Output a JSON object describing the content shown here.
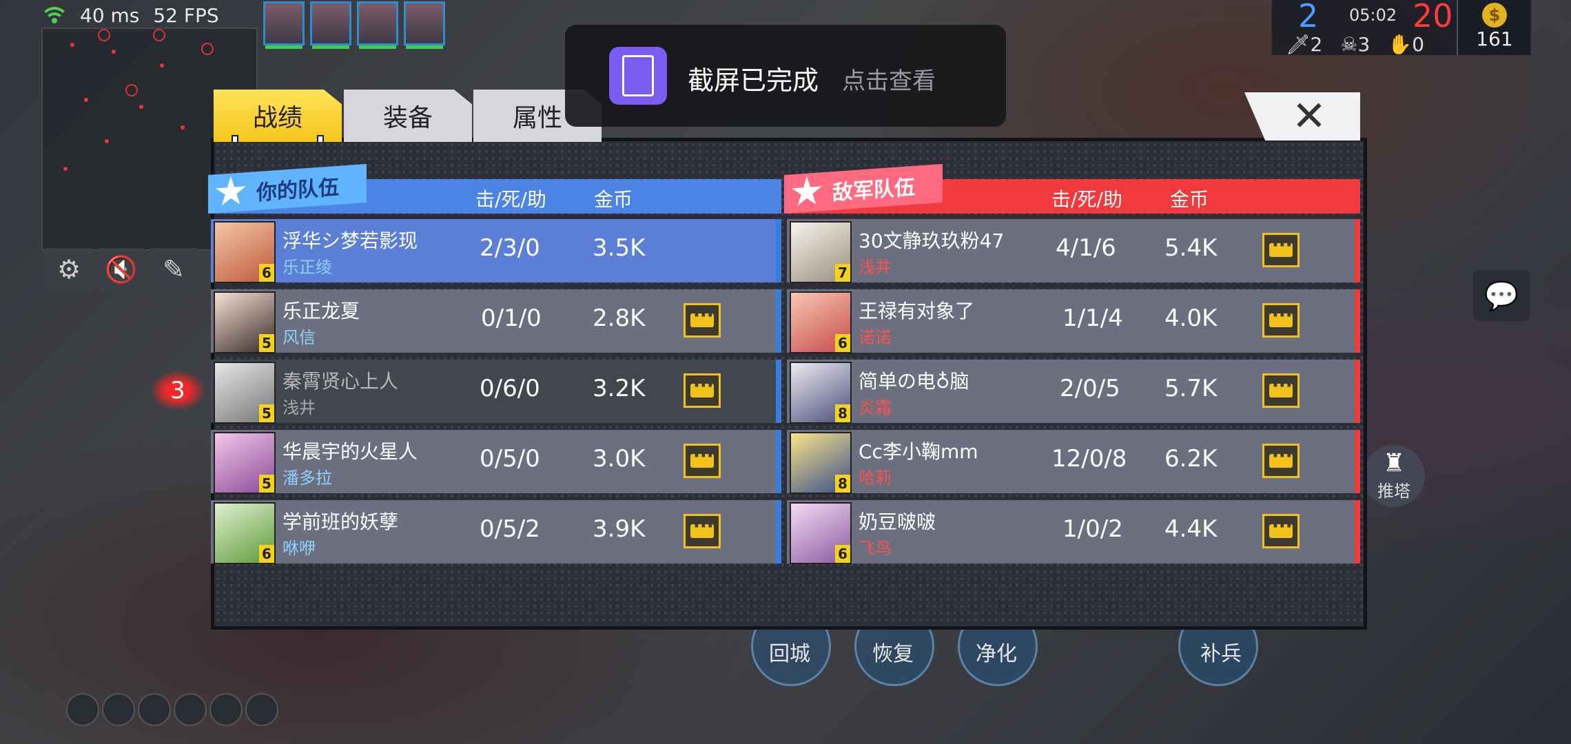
{
  "hud": {
    "ping": "40 ms",
    "fps": "52 FPS",
    "score_blue": "2",
    "game_time": "05:02",
    "score_red": "20",
    "kills": "2",
    "deaths": "3",
    "assists": "0",
    "gold": "161",
    "kill_count_marker": "3",
    "tower_label": "推塔",
    "skills": [
      "回城",
      "恢复",
      "净化",
      "补兵"
    ]
  },
  "toast": {
    "title": "截屏已完成",
    "link": "点击查看"
  },
  "tabs": [
    "战绩",
    "装备",
    "属性"
  ],
  "active_tab": "战绩",
  "headers": {
    "my_team": "你的队伍",
    "enemy_team": "敌军队伍",
    "kda": "击/死/助",
    "gold": "金币"
  },
  "my_team": [
    {
      "player": "浮华シ梦若影现",
      "hero": "乐正绫",
      "level": "6",
      "kda": "2/3/0",
      "gold": "3.5K"
    },
    {
      "player": "乐正龙夏",
      "hero": "风信",
      "level": "5",
      "kda": "0/1/0",
      "gold": "2.8K"
    },
    {
      "player": "秦霄贤心上人",
      "hero": "浅井",
      "level": "5",
      "kda": "0/6/0",
      "gold": "3.2K"
    },
    {
      "player": "华晨宇的火星人",
      "hero": "潘多拉",
      "level": "5",
      "kda": "0/5/0",
      "gold": "3.0K"
    },
    {
      "player": "学前班的妖孽",
      "hero": "咻咿",
      "level": "6",
      "kda": "0/5/2",
      "gold": "3.9K"
    }
  ],
  "enemy_team": [
    {
      "player": "30文静玖玖粉47",
      "hero": "浅井",
      "level": "7",
      "kda": "4/1/6",
      "gold": "5.4K"
    },
    {
      "player": "王禄有对象了",
      "hero": "诺诺",
      "level": "6",
      "kda": "1/1/4",
      "gold": "4.0K"
    },
    {
      "player": "简单の电♁脑",
      "hero": "炎霜",
      "level": "8",
      "kda": "2/0/5",
      "gold": "5.7K"
    },
    {
      "player": "Cc李小鞠mm",
      "hero": "哈莉",
      "level": "8",
      "kda": "12/0/8",
      "gold": "6.2K"
    },
    {
      "player": "奶豆啵啵",
      "hero": "飞鸟",
      "level": "6",
      "kda": "1/0/2",
      "gold": "4.4K"
    }
  ]
}
